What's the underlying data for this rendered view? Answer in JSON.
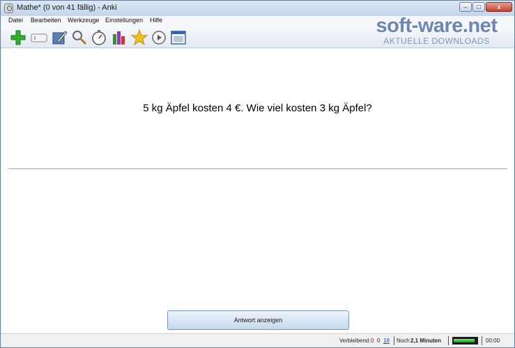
{
  "window": {
    "title": "Mathe* (0 von 41 fällig) - Anki"
  },
  "window_controls": {
    "minimize": "–",
    "maximize": "□",
    "close": "x"
  },
  "menu": [
    {
      "label": "Datei"
    },
    {
      "label": "Bearbeiten"
    },
    {
      "label": "Werkzeuge"
    },
    {
      "label": "Einstellungen"
    },
    {
      "label": "Hilfe"
    }
  ],
  "toolbar": {
    "icons": [
      "add-icon",
      "card-icon",
      "edit-icon",
      "search-icon",
      "timer-icon",
      "statistics-icon",
      "star-icon",
      "play-icon",
      "list-icon"
    ]
  },
  "watermark": {
    "main": "soft-ware.net",
    "sub": "AKTUELLE DOWNLOADS"
  },
  "card": {
    "question": "5 kg Äpfel kosten 4 €. Wie viel kosten 3 kg Äpfel?",
    "show_answer_label": "Antwort anzeigen"
  },
  "status": {
    "remaining_label": "Verbleibend:",
    "new_count": "0",
    "learning_count": "0",
    "review_count": "18",
    "time_prefix": "Noch",
    "time_value": "2,1 Minuten",
    "progress_fraction": 0.9,
    "timer": "00:00"
  },
  "colors": {
    "new": "#c00000",
    "review": "#1c3fd0",
    "progress": "#1fbf1f"
  }
}
